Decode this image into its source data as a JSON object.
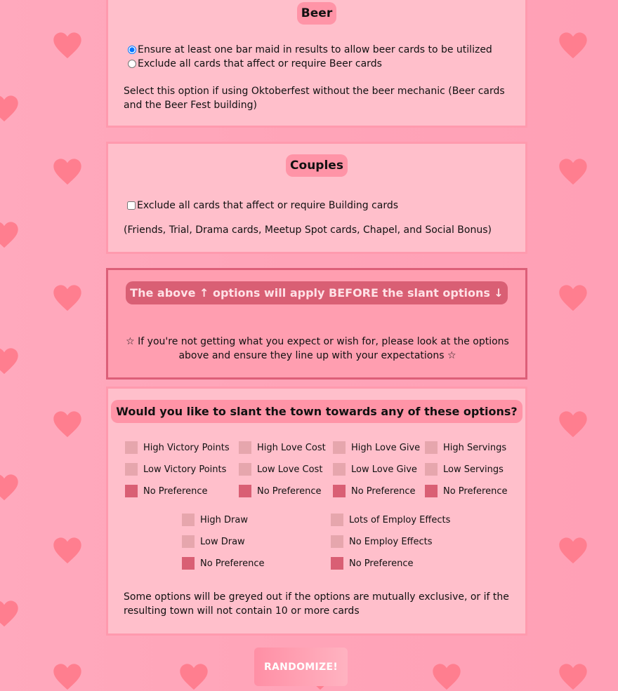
{
  "beer": {
    "title": "Beer",
    "option_maid": "Ensure at least one bar maid in results to allow beer cards to be utilized",
    "option_exclude": "Exclude all cards that affect or require Beer cards",
    "selected": "option_maid",
    "note": "Select this option if using Oktoberfest without the beer mechanic (Beer cards and the Beer Fest building)"
  },
  "couples": {
    "title": "Couples",
    "exclude_label": "Exclude all cards that affect or require Building cards",
    "exclude_checked": false,
    "note": "(Friends, Trial, Drama cards, Meetup Spot cards, Chapel, and Social Bonus)"
  },
  "warning": {
    "title": "The above ↑ options will apply BEFORE the slant options ↓",
    "text": "☆ If you're not getting what you expect or wish for, please look at the options above and ensure they line up with your expectations ☆"
  },
  "slant": {
    "title": "Would you like to slant the town towards any of these options?",
    "col1": [
      "High Victory Points",
      "Low Victory Points",
      "No Preference"
    ],
    "col2": [
      "High Love Cost",
      "Low Love Cost",
      "No Preference"
    ],
    "col3": [
      "High Love Give",
      "Low Love Give",
      "No Preference"
    ],
    "col4": [
      "High Servings",
      "Low Servings",
      "No Preference"
    ],
    "col5": [
      "High Draw",
      "Low Draw",
      "No Preference"
    ],
    "col6": [
      "Lots of Employ Effects",
      "No Employ Effects",
      "No Preference"
    ],
    "selected_each": "No Preference",
    "note": "Some options will be greyed out if the options are mutually exclusive, or if the resulting town will not contain 10 or more cards"
  },
  "randomize_label": "RANDOMIZE!",
  "colors": {
    "panel": "#ffbfcb",
    "accent": "#ff94a7",
    "selected": "#d95f74",
    "heart": "#ff7e8f"
  }
}
